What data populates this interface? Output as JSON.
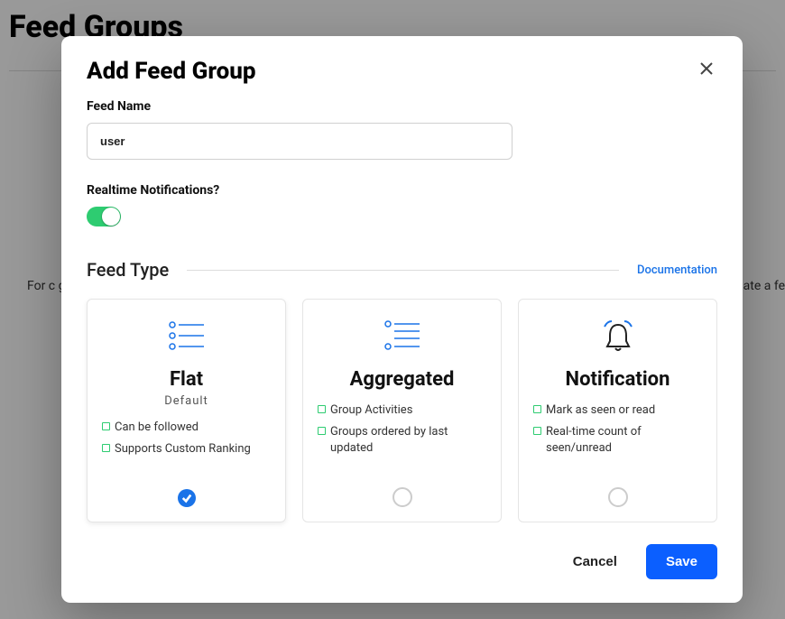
{
  "page": {
    "title": "Feed Groups",
    "bg_left": "For c\ngroup",
    "bg_right": "t you se\nate a fe"
  },
  "modal": {
    "title": "Add Feed Group",
    "feed_name_label": "Feed Name",
    "feed_name_value": "user",
    "realtime_label": "Realtime Notifications?",
    "realtime_on": true,
    "feed_type_label": "Feed Type",
    "doc_link": "Documentation",
    "cards": [
      {
        "title": "Flat",
        "subtitle": "Default",
        "features": [
          "Can be followed",
          "Supports Custom Ranking"
        ],
        "selected": true
      },
      {
        "title": "Aggregated",
        "subtitle": "",
        "features": [
          "Group Activities",
          "Groups ordered by last updated"
        ],
        "selected": false
      },
      {
        "title": "Notification",
        "subtitle": "",
        "features": [
          "Mark as seen or read",
          "Real-time count of seen/unread"
        ],
        "selected": false
      }
    ],
    "cancel": "Cancel",
    "save": "Save"
  }
}
